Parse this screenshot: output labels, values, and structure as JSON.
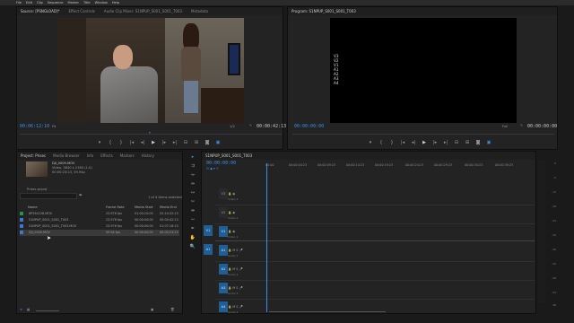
{
  "menu": [
    "File",
    "Edit",
    "Clip",
    "Sequence",
    "Marker",
    "Title",
    "Window",
    "Help"
  ],
  "source": {
    "tabs": [
      "Source: [PSNGLOAD]* ",
      "Effect Controls",
      "Audio Clip Mixer: S1NPUP_S001_S001_T003",
      "Metadata"
    ],
    "timecode_left": "00:06:12:10",
    "fit": "Fit",
    "ratio": "1/2",
    "timecode_right": "00:00:42:13"
  },
  "program": {
    "tab": "Program: S1NPUP_S001_S001_T003",
    "tracks": [
      "V3",
      "V2",
      "V1",
      "A1",
      "A2",
      "A3",
      "A4"
    ],
    "timecode_left": "00:00:00:00",
    "fit": "Full",
    "timecode_right": "00:00:00:00"
  },
  "project": {
    "tabs": [
      "Project: Prisec",
      "Media Browser",
      "Info",
      "Effects",
      "Markers",
      "History"
    ],
    "clip_name": "DJI_0009.MOV",
    "clip_info": "Video, 3840 x 2160 (1.0)",
    "clip_info2": "00:00:23:23, 59.94p",
    "bin_name": "Prisec.prproj",
    "selected_count": "1 of 4 items selected",
    "columns": [
      "Name",
      "Frame Rate",
      "Media Start",
      "Media End"
    ],
    "rows": [
      {
        "name": "8P554228.MOV",
        "fps": "23.976 fps",
        "start": "01:00:15:05",
        "end": "02:14:32:13",
        "color": "#2c8d4e"
      },
      {
        "name": "S1NPUP_S001_S001_T003",
        "fps": "23.976 fps",
        "start": "00:00:00:00",
        "end": "00:00:42:13",
        "color": "#3a78c8"
      },
      {
        "name": "S1NPUP_S001_S001_T003.MOV",
        "fps": "23.976 fps",
        "start": "00:00:00:00",
        "end": "01:07:16:13",
        "color": "#3a78c8"
      },
      {
        "name": "DJI_0009.MOV",
        "fps": "59.94 fps",
        "start": "00:00:00:00",
        "end": "00:00:23:23",
        "color": "#3a78c8"
      }
    ]
  },
  "timeline": {
    "tab": "S1NPUP_S001_S001_T003",
    "timecode": "00:00:00:00",
    "ruler": [
      "00:00",
      "00:00:04:23",
      "00:00:09:23",
      "00:00:14:23",
      "00:00:19:23",
      "00:00:24:23",
      "00:00:29:23",
      "00:00:34:23",
      "00:00:39:23"
    ],
    "tracks": [
      {
        "id": "V3",
        "label": "Video 3"
      },
      {
        "id": "V2",
        "label": "Video 2"
      },
      {
        "id": "V1",
        "label": "Video 1"
      },
      {
        "id": "A1",
        "label": "Audio 1"
      },
      {
        "id": "A2",
        "label": "Audio 2"
      },
      {
        "id": "A3",
        "label": "Audio 3"
      },
      {
        "id": "A4",
        "label": "Audio 4"
      }
    ],
    "src_v": "V1",
    "src_a": "A1"
  },
  "meter_scale": [
    "0",
    "-6",
    "-12",
    "-18",
    "-24",
    "-30",
    "-36",
    "-42",
    "-48",
    "-54",
    "dB"
  ]
}
